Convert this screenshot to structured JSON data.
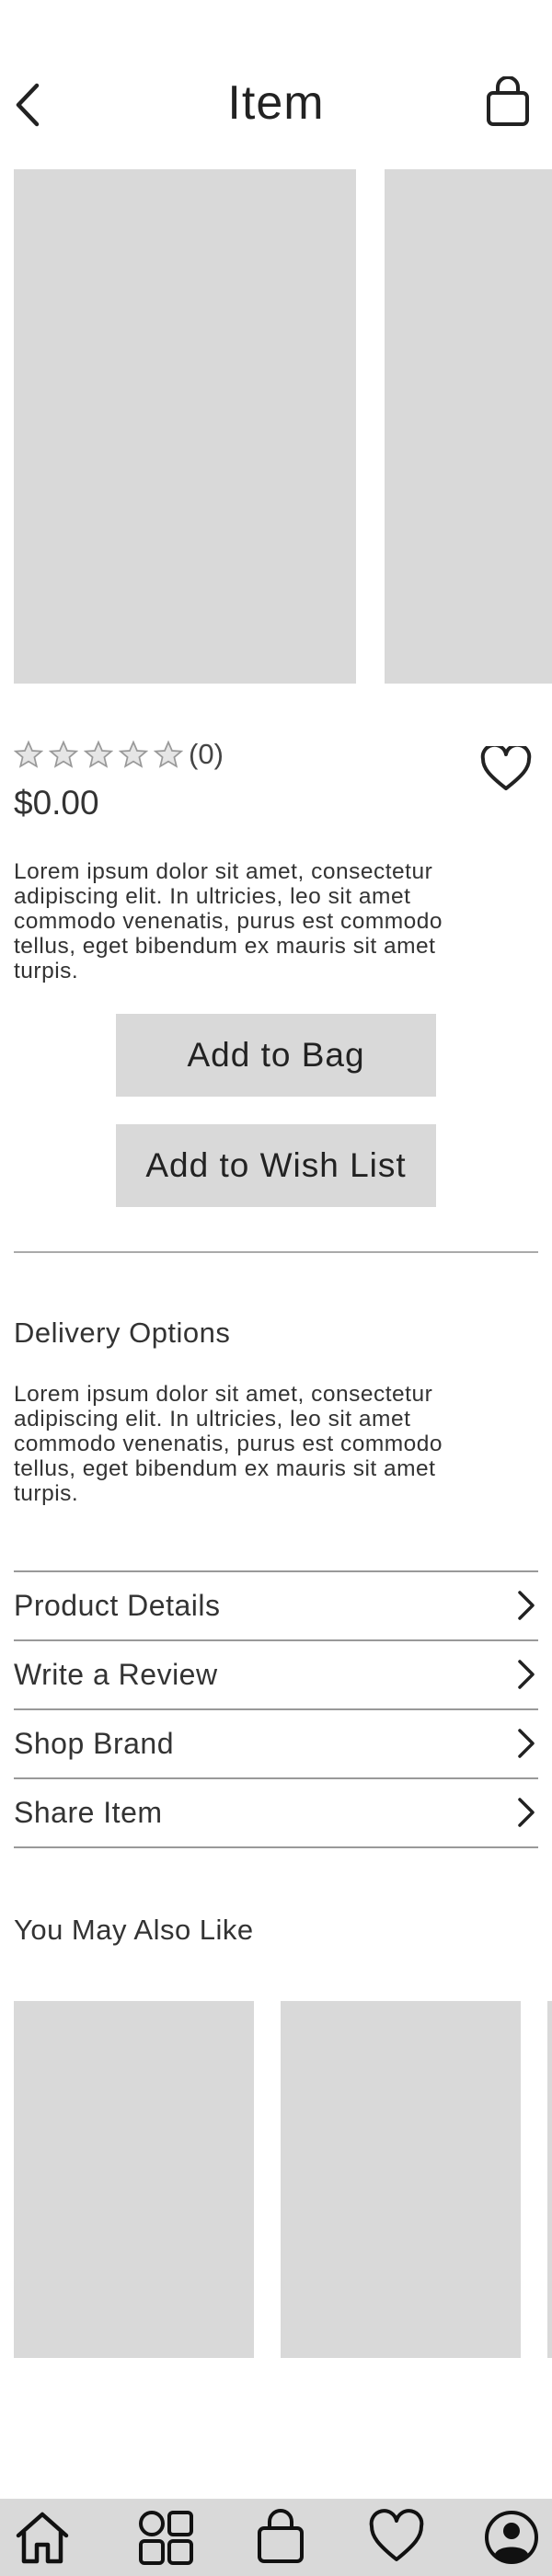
{
  "header": {
    "title": "Item",
    "back_icon": "chevron-left-icon",
    "bag_icon": "shopping-bag-icon"
  },
  "product": {
    "rating": {
      "stars_filled": 0,
      "stars_total": 5,
      "count_label": "(0)"
    },
    "price": "$0.00",
    "description": "Lorem ipsum dolor sit amet, consectetur adipiscing elit. In ultricies, leo sit amet commodo venenatis, purus est commodo tellus, eget bibendum ex mauris sit amet turpis.",
    "favorite_icon": "heart-outline-icon"
  },
  "actions": {
    "add_to_bag": "Add to Bag",
    "add_to_wish_list": "Add to Wish List"
  },
  "delivery": {
    "title": "Delivery Options",
    "text": "Lorem ipsum dolor sit amet, consectetur adipiscing elit. In ultricies, leo sit amet commodo venenatis, purus est commodo tellus, eget bibendum ex mauris sit amet turpis."
  },
  "accordion": [
    {
      "label": "Product Details"
    },
    {
      "label": "Write a Review"
    },
    {
      "label": "Shop Brand"
    },
    {
      "label": "Share Item"
    }
  ],
  "recommendations": {
    "title": "You May Also Like"
  },
  "bottom_nav": [
    {
      "icon": "home-icon"
    },
    {
      "icon": "grid-icon"
    },
    {
      "icon": "shopping-bag-icon"
    },
    {
      "icon": "heart-outline-icon"
    },
    {
      "icon": "account-icon"
    }
  ],
  "colors": {
    "placeholder": "#d9d9d9",
    "text": "#333333",
    "divider": "#aaaaaa"
  }
}
